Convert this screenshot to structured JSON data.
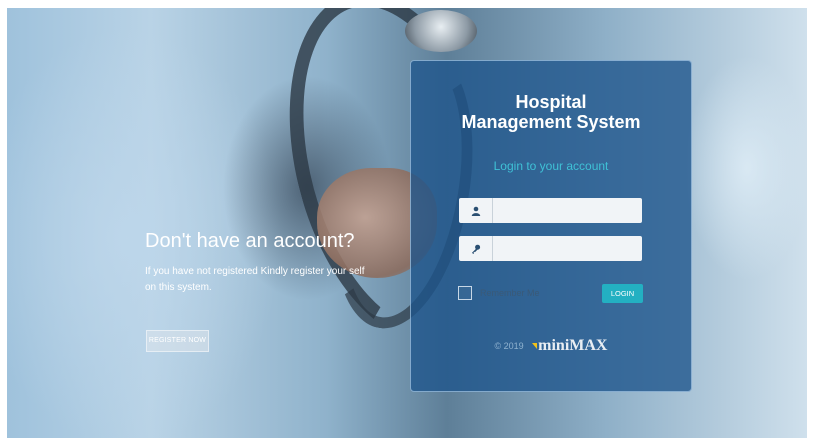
{
  "left": {
    "title": "Don't have an account?",
    "description": "If you have not registered Kindly register your self on this system.",
    "register_label": "REGISTER NOW"
  },
  "panel": {
    "title_line1": "Hospital",
    "title_line2": "Management System",
    "subtitle": "Login to your account"
  },
  "form": {
    "username_icon": "user-icon",
    "password_icon": "key-icon",
    "username_value": "",
    "password_value": "",
    "remember_label": "Remember Me",
    "login_label": "LOGIN"
  },
  "footer": {
    "copyright": "© 2019",
    "brand": "miniMAX",
    "brand_color": "#f2c218"
  },
  "colors": {
    "panel": "#1e558c",
    "accent": "#3fc1d6",
    "login_button": "#23b0c2"
  }
}
